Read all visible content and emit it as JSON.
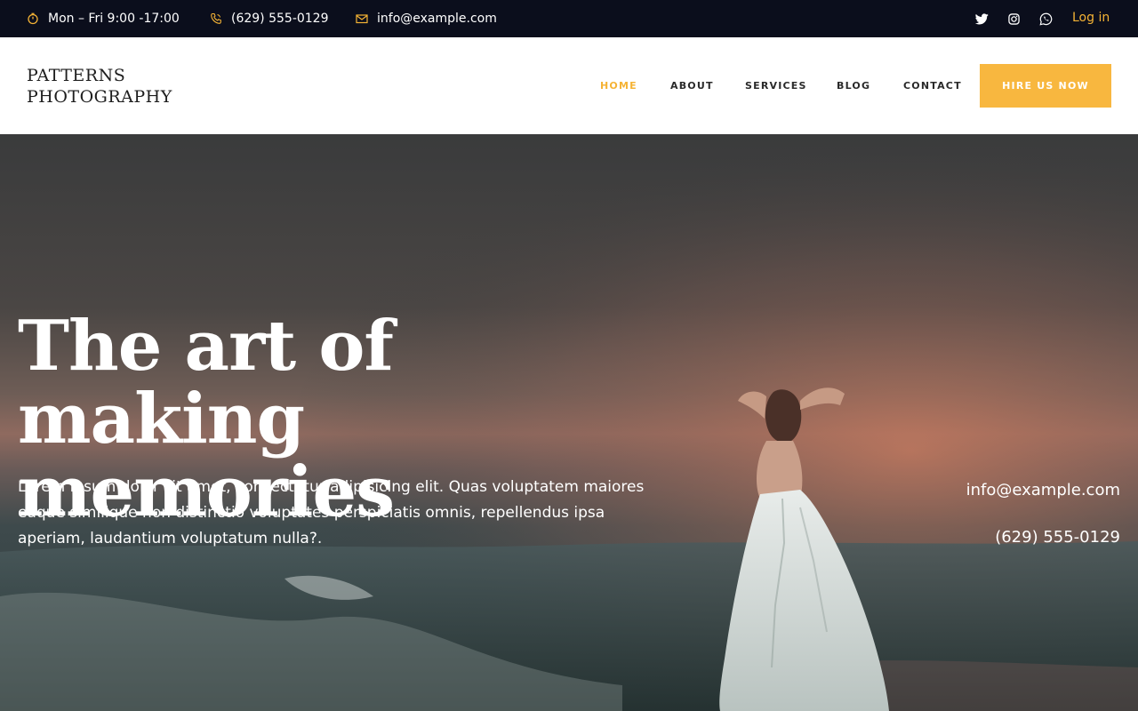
{
  "topbar": {
    "hours": "Mon – Fri 9:00 -17:00",
    "phone": "(629) 555-0129",
    "email": "info@example.com",
    "login": "Log in",
    "icons": [
      "clock-icon",
      "phone-icon",
      "mail-icon",
      "twitter-icon",
      "instagram-icon",
      "whatsapp-icon"
    ]
  },
  "header": {
    "logo_line1": "PATTERNS",
    "logo_line2": "PHOTOGRAPHY",
    "nav": {
      "home": "HOME",
      "about": "ABOUT",
      "services": "SERVICES",
      "blog": "BLOG",
      "contact": "CONTACT"
    },
    "cta": "HIRE US NOW"
  },
  "hero": {
    "title_line1": "The art of making",
    "title_line2": "memories",
    "text": "Lorem ipsum dolor sit amet, consectetur adipisicing elit. Quas voluptatem maiores eaque similique non distinctio voluptates perspiciatis omnis, repellendus ipsa aperiam, laudantium voluptatum nulla?.",
    "email": "info@example.com",
    "phone": "(629) 555-0129"
  },
  "colors": {
    "accent": "#f8b73f",
    "topbar_bg": "#0b0e1c",
    "text_dark": "#2a2a2a"
  }
}
